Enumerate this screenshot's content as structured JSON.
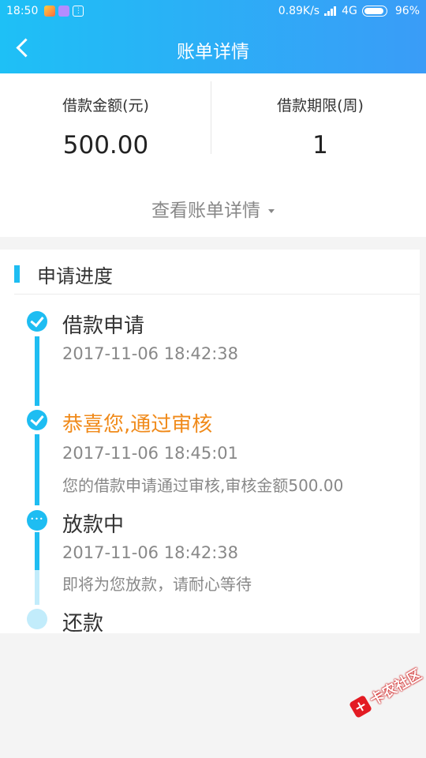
{
  "status_bar": {
    "time": "18:50",
    "network_speed": "0.89K/s",
    "network_type": "4G",
    "battery": "96%"
  },
  "header": {
    "title": "账单详情"
  },
  "summary": {
    "loan_amount_label": "借款金额(元)",
    "loan_amount_value": "500.00",
    "loan_term_label": "借款期限(周)",
    "loan_term_value": "1",
    "view_details_label": "查看账单详情"
  },
  "progress": {
    "section_title": "申请进度",
    "steps": [
      {
        "title": "借款申请",
        "time": "2017-11-06 18:42:38",
        "desc": "",
        "status": "done"
      },
      {
        "title": "恭喜您,通过审核",
        "time": "2017-11-06 18:45:01",
        "desc": "您的借款申请通过审核,审核金额500.00",
        "status": "done"
      },
      {
        "title": "放款中",
        "time": "2017-11-06 18:42:38",
        "desc": "即将为您放款，请耐心等待",
        "status": "in-progress"
      },
      {
        "title": "还款",
        "time": "",
        "desc": "",
        "status": "pending"
      }
    ]
  },
  "colors": {
    "accent": "#1ebdf2",
    "accent_light": "#c2ecfb",
    "highlight": "#f08a1a"
  },
  "watermark": {
    "text": "卡农社区"
  }
}
